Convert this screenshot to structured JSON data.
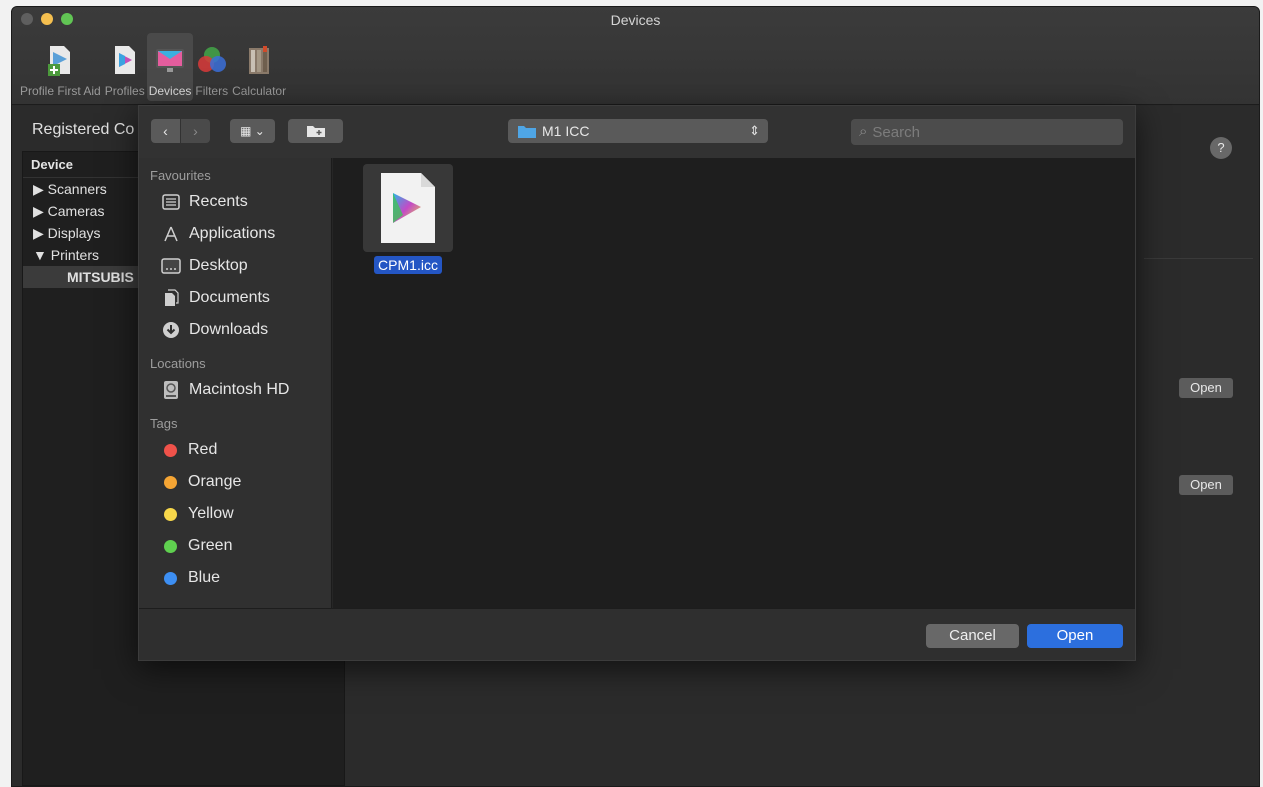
{
  "window": {
    "title": "Devices"
  },
  "toolbar": {
    "items": [
      {
        "label": "Profile First Aid",
        "icon": "profile-first-aid-icon"
      },
      {
        "label": "Profiles",
        "icon": "profiles-icon"
      },
      {
        "label": "Devices",
        "icon": "devices-icon",
        "active": true
      },
      {
        "label": "Filters",
        "icon": "filters-icon"
      },
      {
        "label": "Calculator",
        "icon": "calculator-icon"
      }
    ]
  },
  "left_pane": {
    "title": "Registered Co",
    "column_header": "Device",
    "tree": [
      {
        "label": "▶ Scanners"
      },
      {
        "label": "▶ Cameras"
      },
      {
        "label": "▶ Displays"
      },
      {
        "label": "▼ Printers"
      },
      {
        "label": "MITSUBIS"
      }
    ]
  },
  "right_pane": {
    "help_label": "?",
    "open_label_1": "Open",
    "open_label_2": "Open"
  },
  "dialog": {
    "location": "M1 ICC",
    "search_placeholder": "Search",
    "sidebar": {
      "favourites_title": "Favourites",
      "favourites": [
        {
          "label": "Recents",
          "icon": "recents-icon"
        },
        {
          "label": "Applications",
          "icon": "applications-icon"
        },
        {
          "label": "Desktop",
          "icon": "desktop-icon"
        },
        {
          "label": "Documents",
          "icon": "documents-icon"
        },
        {
          "label": "Downloads",
          "icon": "downloads-icon"
        }
      ],
      "locations_title": "Locations",
      "locations": [
        {
          "label": "Macintosh HD",
          "icon": "hard-drive-icon"
        }
      ],
      "tags_title": "Tags",
      "tags": [
        {
          "label": "Red",
          "color": "#f0524a"
        },
        {
          "label": "Orange",
          "color": "#f5a534"
        },
        {
          "label": "Yellow",
          "color": "#f7d74a"
        },
        {
          "label": "Green",
          "color": "#5fd04f"
        },
        {
          "label": "Blue",
          "color": "#3d8ff3"
        }
      ]
    },
    "files": [
      {
        "name": "CPM1.icc",
        "selected": true
      }
    ],
    "cancel_label": "Cancel",
    "open_label": "Open"
  }
}
